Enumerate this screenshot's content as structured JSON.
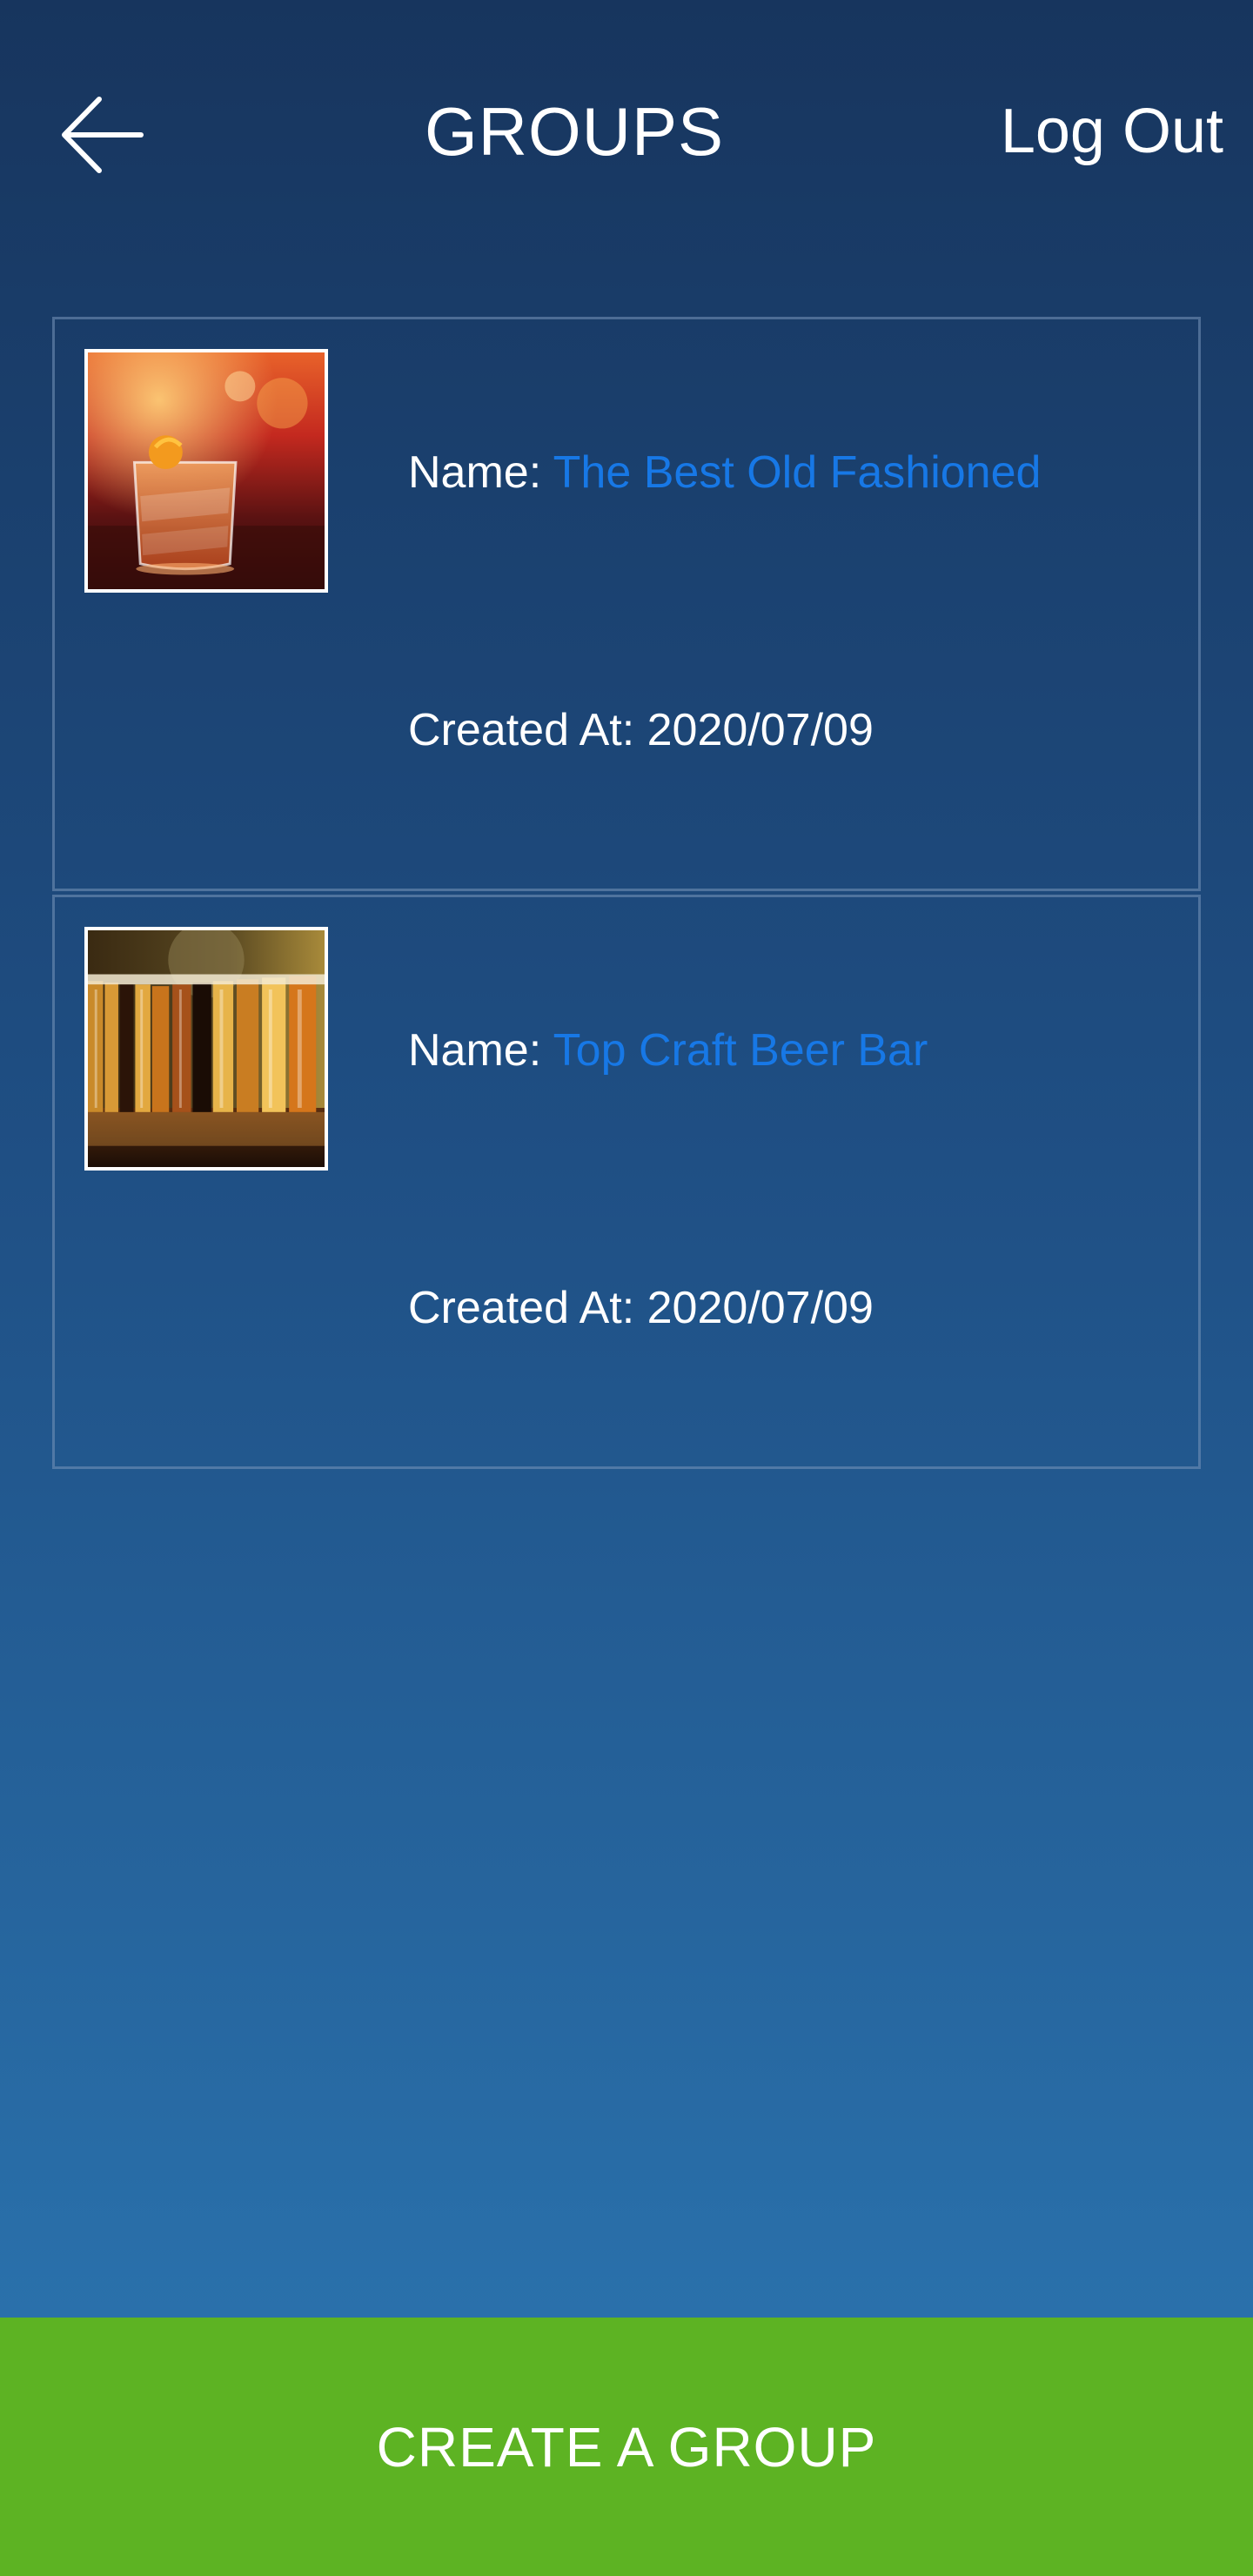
{
  "header": {
    "back_icon": "arrow-left-icon",
    "title": "GROUPS",
    "logout_label": "Log Out"
  },
  "groups": [
    {
      "image": "cocktail-old-fashioned-photo",
      "name_label": "Name:",
      "name": "The Best Old Fashioned",
      "created_label": "Created At:",
      "created_at": "2020/07/09"
    },
    {
      "image": "craft-beer-glasses-photo",
      "name_label": "Name:",
      "name": "Top Craft Beer Bar",
      "created_label": "Created At:",
      "created_at": "2020/07/09"
    }
  ],
  "create_button": {
    "label": "CREATE A GROUP"
  },
  "colors": {
    "background_top": "#17355e",
    "background_bottom": "#2c78b4",
    "name_link": "#1778e6",
    "create_button": "#5db323"
  }
}
